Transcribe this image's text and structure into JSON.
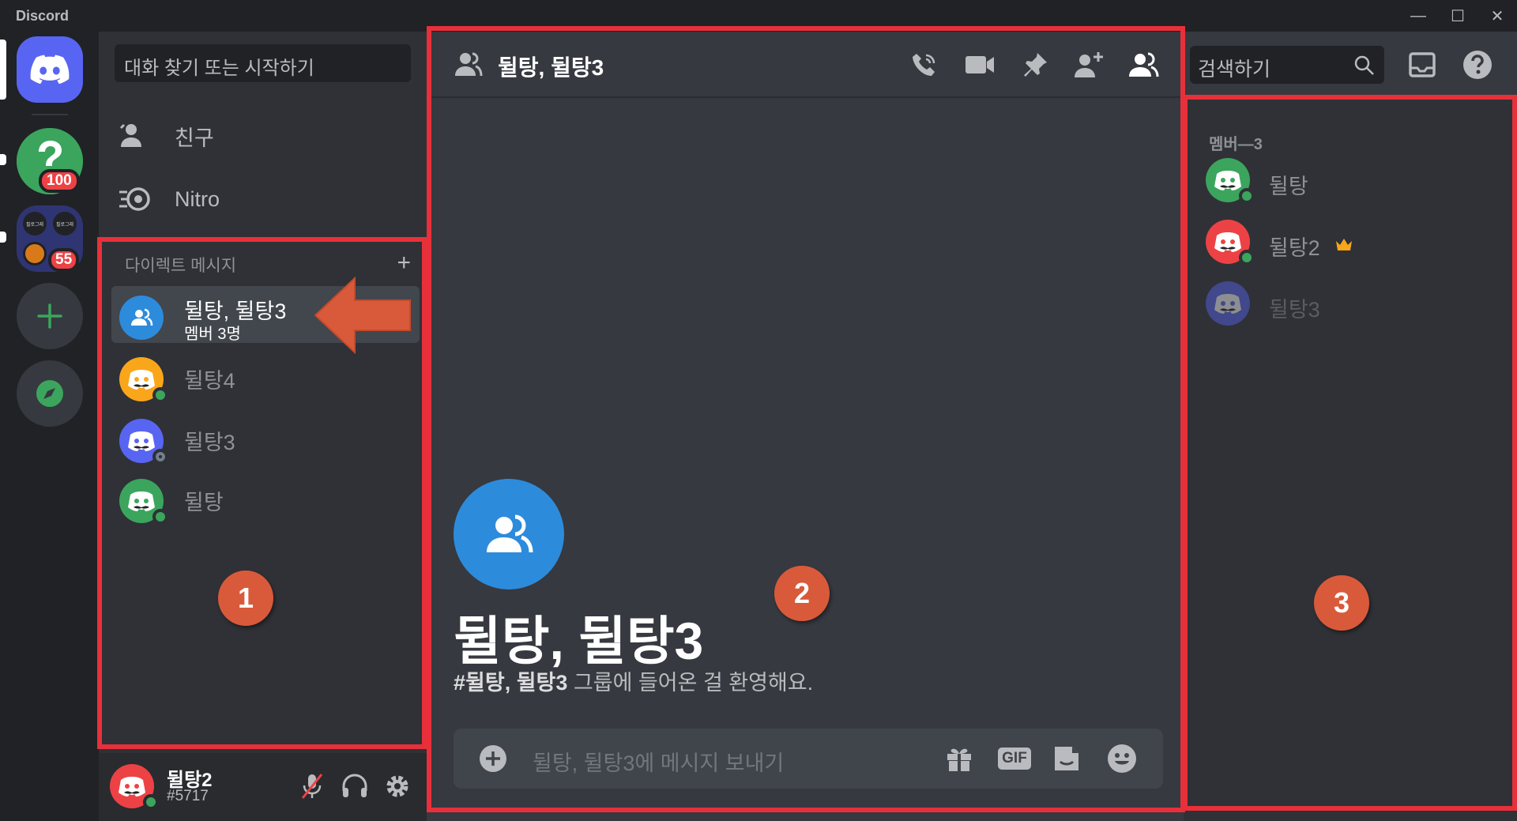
{
  "app": {
    "brand": "Discord"
  },
  "window": {
    "minimize": "—",
    "maximize": "☐",
    "close": "✕"
  },
  "servers": [
    {
      "name": "home",
      "badge": ""
    },
    {
      "name": "server-2",
      "badge": "100"
    },
    {
      "name": "server-3",
      "badge": "55"
    }
  ],
  "server_3_thumb_text": "필로그래",
  "dm_sidebar": {
    "search_placeholder": "대화 찾기 또는 시작하기",
    "nav": [
      {
        "label": "친구",
        "icon": "friends-icon"
      },
      {
        "label": "Nitro",
        "icon": "nitro-icon"
      }
    ],
    "dm_header": "다이렉트 메시지",
    "dms": [
      {
        "name": "뒬탕, 뒬탕3",
        "subtitle": "멤버 3명",
        "active": true
      },
      {
        "name": "뒬탕4",
        "status": "online"
      },
      {
        "name": "뒬탕3",
        "status": "offline"
      },
      {
        "name": "뒬탕",
        "status": "online"
      }
    ]
  },
  "user_panel": {
    "name": "뒬탕2",
    "tag": "#5717"
  },
  "chat": {
    "title": "뒬탕, 뒬탕3",
    "welcome_title": "뒬탕, 뒬탕3",
    "welcome_bold": "#뒬탕, 뒬탕3",
    "welcome_rest": " 그룹에 들어온 걸 환영해요.",
    "composer_placeholder": "뒬탕, 뒬탕3에 메시지 보내기",
    "gif_label": "GIF"
  },
  "toolbar": {
    "search_placeholder": "검색하기"
  },
  "members": {
    "header": "멤버—3",
    "list": [
      {
        "name": "뒬탕",
        "status": "online",
        "owner": false
      },
      {
        "name": "뒬탕2",
        "status": "online",
        "owner": true
      },
      {
        "name": "뒬탕3",
        "status": "offline",
        "owner": false
      }
    ]
  },
  "annotations": [
    "1",
    "2",
    "3"
  ],
  "colors": {
    "blurple": "#5865f2",
    "green": "#3ba55d",
    "red": "#ed4245",
    "yellow": "#faa61a",
    "annotation_red": "#e8303a",
    "annotation_orange": "#d95a3a"
  }
}
